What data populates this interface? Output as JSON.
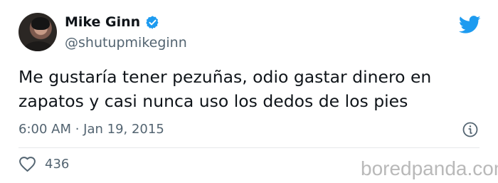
{
  "author": {
    "display_name": "Mike Ginn",
    "handle": "@shutupmikeginn",
    "verified": true,
    "avatar": "profile-photo"
  },
  "tweet": {
    "text": "Me gustaría tener pezuñas, odio gastar dinero en\nzapatos y casi nunca uso los dedos de los pies",
    "timestamp": "6:00 AM · Jan 19, 2015"
  },
  "engagement": {
    "likes": "436"
  },
  "watermark": {
    "text": "boredpanda.com"
  },
  "icons": {
    "verified": "verified-badge-icon",
    "brand": "twitter-bird-icon",
    "info": "info-icon",
    "like": "heart-icon"
  },
  "colors": {
    "twitter_blue": "#1d9bf0",
    "secondary_text": "#536471",
    "primary_text": "#0f1419",
    "watermark": "#b9b9b9"
  }
}
